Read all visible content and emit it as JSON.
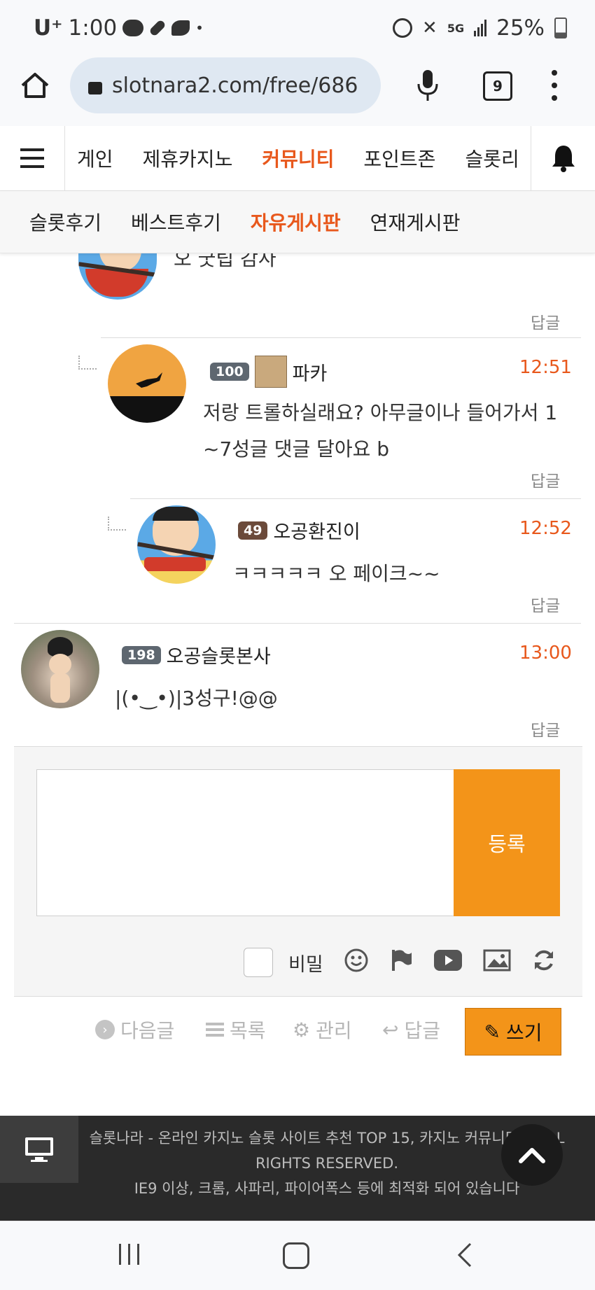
{
  "status_bar": {
    "time": "1:00",
    "carrier": "U⁺",
    "battery": "25%",
    "network": "5G"
  },
  "browser": {
    "url": "slotnara2.com/free/686",
    "tab_count": "9"
  },
  "nav": {
    "items": [
      "게인",
      "제휴카지노",
      "커뮤니티",
      "포인트존",
      "슬롯리"
    ],
    "active": "커뮤니티"
  },
  "subnav": {
    "items": [
      "슬롯후기",
      "베스트후기",
      "자유게시판",
      "연재게시판"
    ],
    "active": "자유게시판"
  },
  "comments": [
    {
      "name": "",
      "level": "",
      "time": "",
      "text": "오 굿팁 감사",
      "reply": "답글"
    },
    {
      "name": "파카",
      "level": "100",
      "time": "12:51",
      "text_line1": "저랑 트롤하실래요? 아무글이나 들어가서 1",
      "text_line2": "~7성글 댓글 달아요 b",
      "reply": "답글"
    },
    {
      "name": "오공환진이",
      "level": "49",
      "time": "12:52",
      "text": "ㅋㅋㅋㅋㅋ 오 페이크~~",
      "reply": "답글"
    },
    {
      "name": "오공슬롯본사",
      "level": "198",
      "time": "13:00",
      "text": "|(•‿•)|3성구!@@",
      "reply": "답글"
    }
  ],
  "comment_form": {
    "submit_label": "등록",
    "secret_label": "비밀"
  },
  "actions": {
    "next": "다음글",
    "list": "목록",
    "manage": "관리",
    "reply": "답글",
    "write": "쓰기"
  },
  "footer": {
    "line1": "슬롯나라 - 온라인 카지노 슬롯 사이트 추천 TOP 15, 카지노 커뮤니티 ©ALL",
    "line2": "RIGHTS RESERVED.",
    "line3": "IE9 이상, 크롬, 사파리, 파이어폭스 등에 최적화 되어 있습니다"
  },
  "colors": {
    "accent": "#e8581c",
    "button": "#f39419",
    "footer": "#2a2a2a"
  }
}
